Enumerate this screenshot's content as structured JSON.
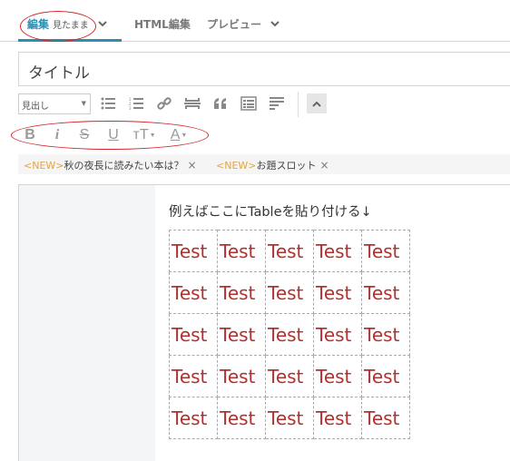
{
  "tabs": {
    "edit_label": "編集",
    "edit_mode": "見たまま",
    "html_label": "HTML編集",
    "preview_label": "プレビュー"
  },
  "title": {
    "placeholder": "タイトル"
  },
  "toolbar": {
    "heading_select": "見出し",
    "icons": [
      "bulleted-list-icon",
      "numbered-list-icon",
      "link-icon",
      "more-separator-icon",
      "quote-icon",
      "table-of-contents-icon",
      "horizontal-rule-icon"
    ],
    "collapse_icon": "chevron-up-icon"
  },
  "format_toolbar": {
    "bold": "B",
    "italic": "i",
    "strike": "S",
    "underline": "U",
    "font_size": "тT",
    "font_color": "A"
  },
  "tags": [
    {
      "prefix": "<NEW>",
      "text": "秋の夜長に読みたい本は？",
      "close": "×"
    },
    {
      "prefix": "<NEW>",
      "text": "お題スロット",
      "close": "×"
    }
  ],
  "editor": {
    "lead_text": "例えばここにTableを貼り付ける↓",
    "table": [
      [
        "Test",
        "Test",
        "Test",
        "Test",
        "Test"
      ],
      [
        "Test",
        "Test",
        "Test",
        "Test",
        "Test"
      ],
      [
        "Test",
        "Test",
        "Test",
        "Test",
        "Test"
      ],
      [
        "Test",
        "Test",
        "Test",
        "Test",
        "Test"
      ],
      [
        "Test",
        "Test",
        "Test",
        "Test",
        "Test"
      ]
    ]
  },
  "colors": {
    "accent": "#2b8fb3",
    "annotation_red": "#d6252b",
    "tag_new": "#e8a33d",
    "table_text": "#b0312f"
  }
}
